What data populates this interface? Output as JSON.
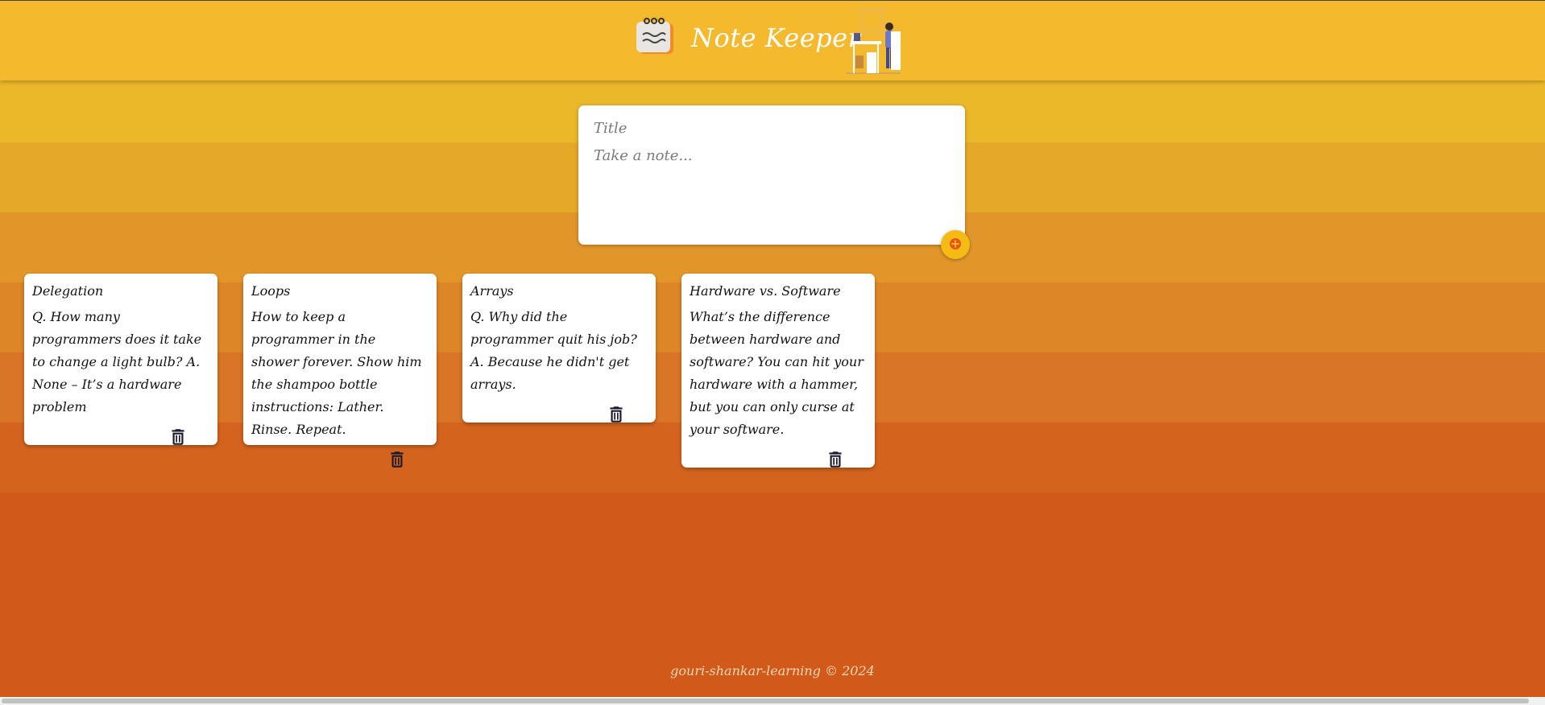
{
  "header": {
    "app_title": "Note Keeper"
  },
  "create_note": {
    "title_placeholder": "Title",
    "content_placeholder": "Take a note...",
    "add_button_icon": "plus-icon"
  },
  "notes": [
    {
      "title": "Delegation",
      "content": "Q. How many programmers does it take to change a light bulb? A. None – It’s a hardware problem",
      "delete_icon": "trash-icon"
    },
    {
      "title": "Loops",
      "content": "How to keep a programmer in the shower forever. Show him the shampoo bottle instructions: Lather. Rinse. Repeat.",
      "delete_icon": "trash-icon"
    },
    {
      "title": "Arrays",
      "content": "Q. Why did the programmer quit his job? A. Because he didn't get arrays.",
      "delete_icon": "trash-icon"
    },
    {
      "title": "Hardware vs. Software",
      "content": "What’s the difference between hardware and software? You can hit your hardware with a hammer, but you can only curse at your software.",
      "delete_icon": "trash-icon"
    }
  ],
  "footer": {
    "copyright": "gouri-shankar-learning © 2024"
  },
  "colors": {
    "header_bg": "#f4b92c",
    "accent": "#f5ba13",
    "icon_dark": "#1a1a2e"
  }
}
